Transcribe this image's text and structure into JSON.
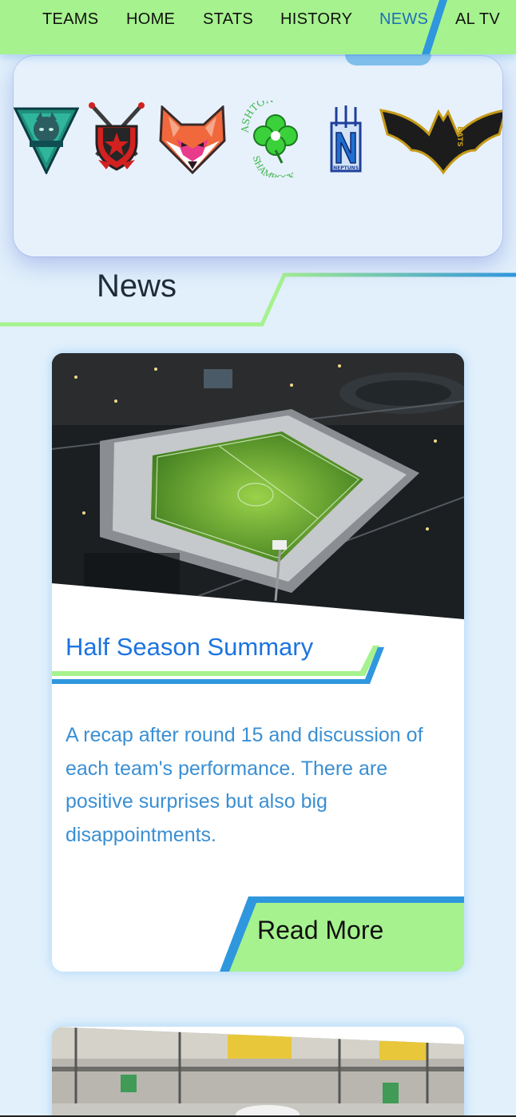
{
  "nav": {
    "items": [
      {
        "label": "TEAMS"
      },
      {
        "label": "HOME"
      },
      {
        "label": "STATS"
      },
      {
        "label": "HISTORY"
      },
      {
        "label": "NEWS",
        "active": true
      },
      {
        "label": "AL TV"
      }
    ]
  },
  "logos": {
    "teams": [
      {
        "name": "wolves",
        "icon": "wolf-shield-icon"
      },
      {
        "name": "warriors",
        "icon": "swords-shield-icon"
      },
      {
        "name": "foxes",
        "icon": "fox-icon"
      },
      {
        "name": "Ashton Shamrock",
        "icon": "shamrock-icon",
        "text_top": "ASHTON",
        "text_bottom": "SHAMROCK"
      },
      {
        "name": "Neptuns",
        "icon": "trident-n-icon",
        "text": "NEPTUNS"
      },
      {
        "name": "Bats",
        "icon": "bat-icon",
        "text": "BATS"
      }
    ]
  },
  "section": {
    "title": "News"
  },
  "news": [
    {
      "title": "Half Season Summary",
      "summary": "A recap after round 15 and discussion of each team's performance. There are positive surprises but also big disappointments.",
      "cta": "Read More",
      "image": "stadium-aerial-night"
    },
    {
      "image": "street-building"
    }
  ],
  "colors": {
    "accent_green": "#a6f28e",
    "accent_blue": "#2f97de",
    "link_blue": "#1c74e0",
    "body_blue": "#3a8fd3",
    "background": "#e2f0fb"
  }
}
